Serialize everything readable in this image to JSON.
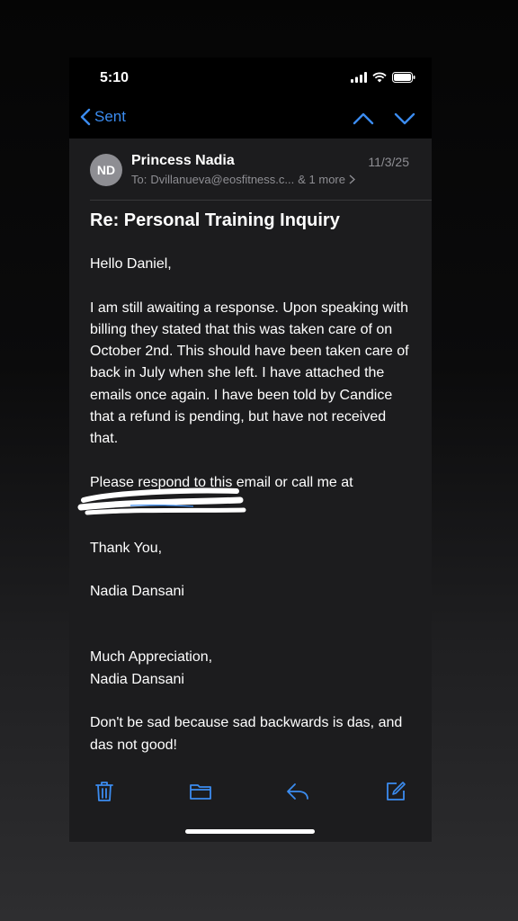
{
  "status_bar": {
    "time": "5:10"
  },
  "nav": {
    "back_label": "Sent"
  },
  "header": {
    "avatar_initials": "ND",
    "sender": "Princess Nadia",
    "date": "11/3/25",
    "to_prefix": "To:",
    "to_address": "Dvillanueva@eosfitness.c...",
    "more": "& 1 more"
  },
  "subject": "Re: Personal Training Inquiry",
  "body": {
    "greeting": "Hello Daniel,",
    "paragraph1": "I am still awaiting a response. Upon speaking with billing they stated that this was taken care of on October 2nd. This should have been taken care of back in July when she left. I have attached the emails once again. I have been told by Candice that a refund is pending, but have not received that.",
    "paragraph2": "Please respond to this email or call me at",
    "thanks": "Thank You,",
    "signature1": "Nadia Dansani",
    "closing": "Much Appreciation,",
    "signature2": "Nadia Dansani",
    "quote": "Don't be sad because sad backwards is das, and das not good!"
  },
  "colors": {
    "accent": "#3b8cf0",
    "background": "#1c1c1e",
    "secondary_text": "#8e8e93"
  },
  "icons": [
    "chevron-left-icon",
    "chevron-up-icon",
    "chevron-down-icon",
    "trash-icon",
    "folder-icon",
    "reply-icon",
    "compose-icon"
  ]
}
